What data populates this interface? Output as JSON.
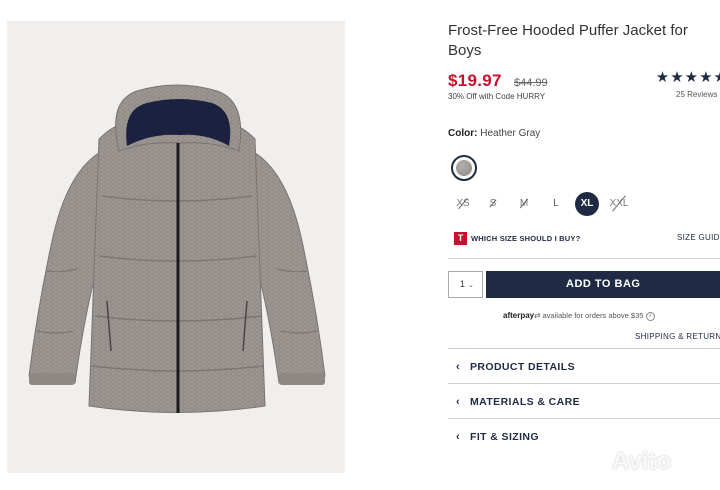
{
  "product": {
    "title": "Frost-Free Hooded Puffer Jacket for Boys",
    "price": "$19.97",
    "original_price": "$44.99",
    "promo": "30% Off with Code HURRY",
    "stars": "★★★★★",
    "rating": 5,
    "reviews": "25 Reviews"
  },
  "color": {
    "label": "Color:",
    "value": "Heather Gray",
    "swatch_color": "#9a9491"
  },
  "sizes": [
    {
      "label": "XS",
      "available": false,
      "selected": false
    },
    {
      "label": "S",
      "available": false,
      "selected": false
    },
    {
      "label": "M",
      "available": false,
      "selected": false
    },
    {
      "label": "L",
      "available": true,
      "selected": false
    },
    {
      "label": "XL",
      "available": true,
      "selected": true
    },
    {
      "label": "XXL",
      "available": false,
      "selected": false
    }
  ],
  "size_help": {
    "logo": "T",
    "label": "WHICH SIZE SHOULD I BUY?",
    "guide": "SIZE GUIDE"
  },
  "cart": {
    "quantity": "1",
    "add_label": "ADD TO BAG"
  },
  "afterpay": {
    "brand": "afterpay",
    "text": "available for orders above $35",
    "info": "i"
  },
  "shipping_link": "SHIPPING & RETURNS",
  "accordions": [
    {
      "label": "PRODUCT DETAILS"
    },
    {
      "label": "MATERIALS & CARE"
    },
    {
      "label": "FIT & SIZING"
    }
  ],
  "watermark": "Avito",
  "colors": {
    "navy": "#1f2a44",
    "sale_red": "#c8102e",
    "jacket_gray": "#9a9491"
  },
  "icons": {
    "accordion_chevron": "chevron-left-icon",
    "quantity_chevron": "chevron-down-icon"
  }
}
